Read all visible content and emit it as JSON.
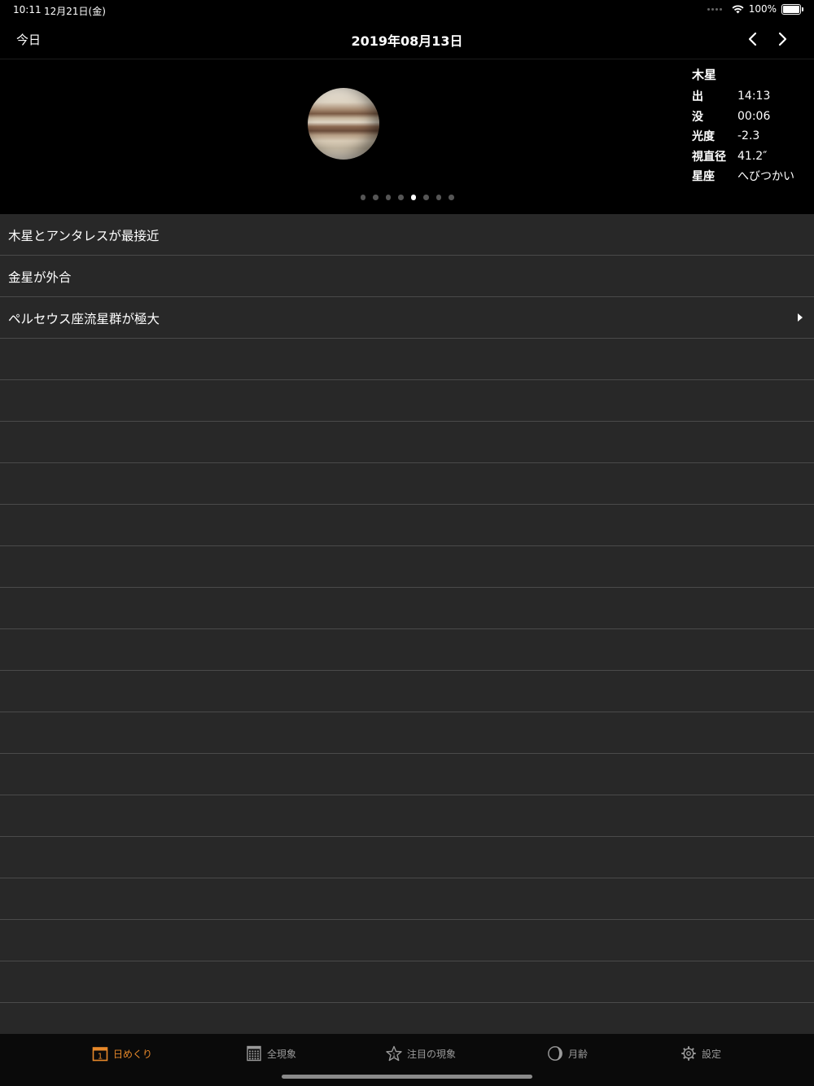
{
  "status_bar": {
    "time": "10:11",
    "date": "12月21日(金)",
    "battery": "100%"
  },
  "nav": {
    "today_label": "今日",
    "title": "2019年08月13日"
  },
  "hero": {
    "planet_name": "木星",
    "details": [
      {
        "key": "出",
        "value": "14:13"
      },
      {
        "key": "没",
        "value": "00:06"
      },
      {
        "key": "光度",
        "value": "-2.3"
      },
      {
        "key": "視直径",
        "value": "41.2″"
      },
      {
        "key": "星座",
        "value": "へびつかい"
      }
    ],
    "pager": {
      "count": 8,
      "active_index": 4
    }
  },
  "events": [
    {
      "label": "木星とアンタレスが最接近",
      "has_detail": false
    },
    {
      "label": "金星が外合",
      "has_detail": false
    },
    {
      "label": "ペルセウス座流星群が極大",
      "has_detail": true
    }
  ],
  "empty_row_count": 17,
  "tabs": [
    {
      "label": "日めくり",
      "icon": "calendar-day-icon",
      "active": true
    },
    {
      "label": "全現象",
      "icon": "calendar-grid-icon",
      "active": false
    },
    {
      "label": "注目の現象",
      "icon": "star-icon",
      "active": false
    },
    {
      "label": "月齢",
      "icon": "moon-phase-icon",
      "active": false
    },
    {
      "label": "設定",
      "icon": "gear-icon",
      "active": false
    }
  ],
  "colors": {
    "accent": "#e8892a",
    "list_bg": "#282828",
    "separator": "#4a4a4a"
  }
}
